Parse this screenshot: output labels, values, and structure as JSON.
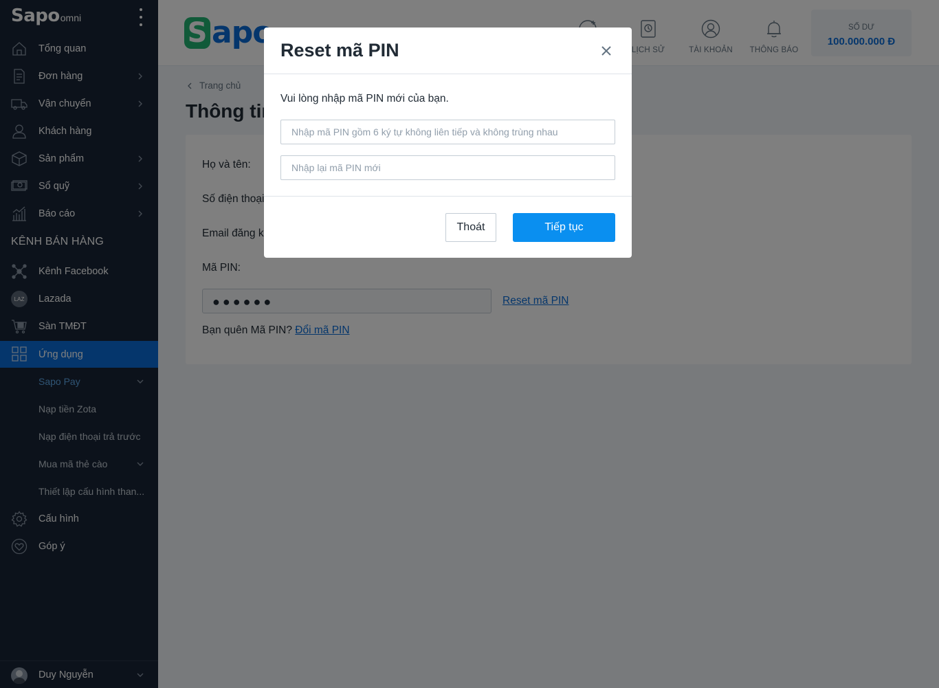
{
  "sidebar": {
    "logo_main": "Sapo",
    "logo_sub": "omni",
    "items": [
      {
        "label": "Tổng quan",
        "icon": "home-icon"
      },
      {
        "label": "Đơn hàng",
        "icon": "orders-icon"
      },
      {
        "label": "Vận chuyển",
        "icon": "truck-icon"
      },
      {
        "label": "Khách hàng",
        "icon": "user-icon"
      },
      {
        "label": "Sản phẩm",
        "icon": "box-icon"
      },
      {
        "label": "Sổ quỹ",
        "icon": "cash-icon"
      },
      {
        "label": "Báo cáo",
        "icon": "report-icon"
      }
    ],
    "section_title": "KÊNH BÁN HÀNG",
    "channels": [
      {
        "label": "Kênh Facebook",
        "icon": "facebook-network-icon"
      },
      {
        "label": "Lazada",
        "icon": "lazada-icon",
        "badge": "LAZ"
      },
      {
        "label": "Sàn TMĐT",
        "icon": "marketplace-icon"
      },
      {
        "label": "Ứng dụng",
        "icon": "apps-grid-icon"
      }
    ],
    "sub_items": [
      {
        "label": "Sapo Pay"
      },
      {
        "label": "Nạp tiền Zota"
      },
      {
        "label": "Nạp điện thoại trả trước"
      },
      {
        "label": "Mua mã thẻ cào"
      },
      {
        "label": "Thiết lập cấu hình than..."
      }
    ],
    "bottom_items": [
      {
        "label": "Cấu hình",
        "icon": "gear-icon"
      },
      {
        "label": "Góp ý",
        "icon": "heart-feedback-icon"
      }
    ],
    "user_name": "Duy Nguyễn",
    "active_color": "#0a6dd8",
    "sub_active_color": "#5fa8e8"
  },
  "header": {
    "brand_s": "S",
    "brand_rest": "apo",
    "nav": [
      {
        "label": "LỊCH SỬ",
        "icon": "history-icon"
      },
      {
        "label": "TÀI KHOẢN",
        "icon": "account-icon"
      },
      {
        "label": "THÔNG BÁO",
        "icon": "bell-icon"
      }
    ],
    "balance_label": "SỐ DƯ",
    "balance_value": "100.000.000 Đ"
  },
  "main": {
    "breadcrumb": "Trang chủ",
    "page_title": "Thông tin",
    "fields": {
      "name_label": "Họ và tên:",
      "phone_label": "Số điện thoại",
      "email_label": "Email đăng k",
      "pin_label": "Mã PIN:"
    },
    "pin_value": "●●●●●●",
    "reset_link": "Reset mã PIN",
    "forgot_text": "Bạn quên Mã PIN?",
    "change_link": "Đổi mã PIN"
  },
  "modal": {
    "title": "Reset mã PIN",
    "description": "Vui lòng nhập mã PIN mới của bạn.",
    "pin_placeholder": "Nhập mã PIN gồm 6 ký tự không liên tiếp và không trùng nhau",
    "confirm_placeholder": "Nhập lại mã PIN mới",
    "cancel_label": "Thoát",
    "continue_label": "Tiếp tục"
  }
}
